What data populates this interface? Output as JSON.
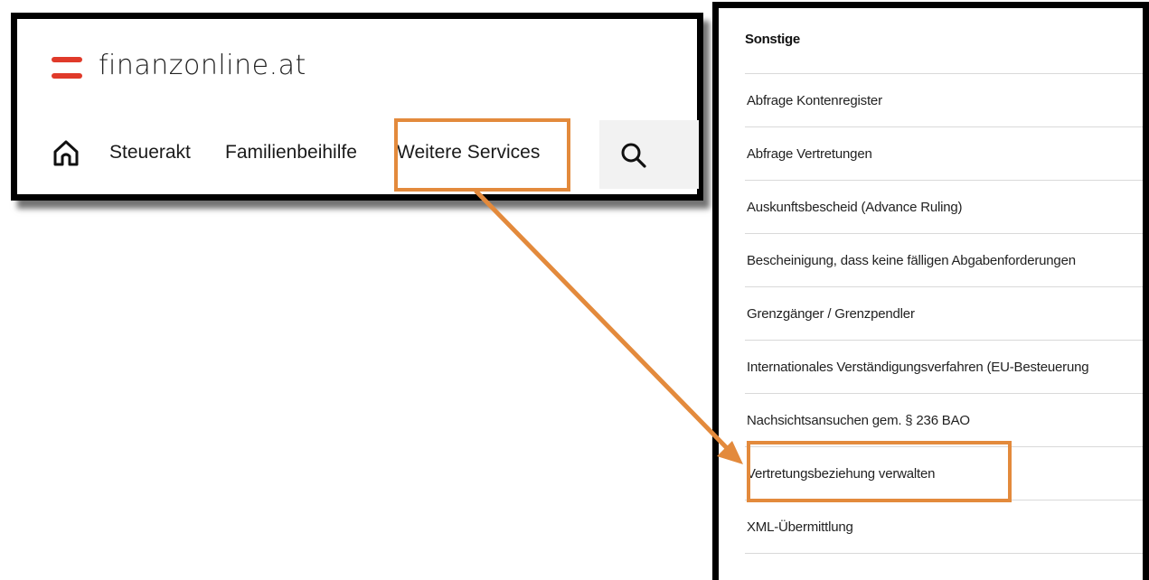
{
  "header": {
    "logo_text": "finanzonline.at",
    "nav": [
      {
        "label": "Steuerakt"
      },
      {
        "label": "Familienbeihilfe"
      },
      {
        "label": "Weitere Services"
      }
    ]
  },
  "menu": {
    "title": "Sonstige",
    "items": [
      {
        "label": "Abfrage Kontenregister"
      },
      {
        "label": "Abfrage Vertretungen"
      },
      {
        "label": "Auskunftsbescheid (Advance Ruling)"
      },
      {
        "label": "Bescheinigung, dass keine fälligen Abgabenforderungen"
      },
      {
        "label": "Grenzgänger / Grenzpendler"
      },
      {
        "label": "Internationales Verständigungsverfahren (EU-Besteuerung"
      },
      {
        "label": "Nachsichtsansuchen gem. § 236 BAO"
      },
      {
        "label": "Vertretungsbeziehung verwalten"
      },
      {
        "label": "XML-Übermittlung"
      }
    ]
  },
  "colors": {
    "highlight": "#e38a3c",
    "brand_red": "#e03a2a"
  },
  "icons": [
    "home-icon",
    "search-icon",
    "austria-flag-icon"
  ]
}
